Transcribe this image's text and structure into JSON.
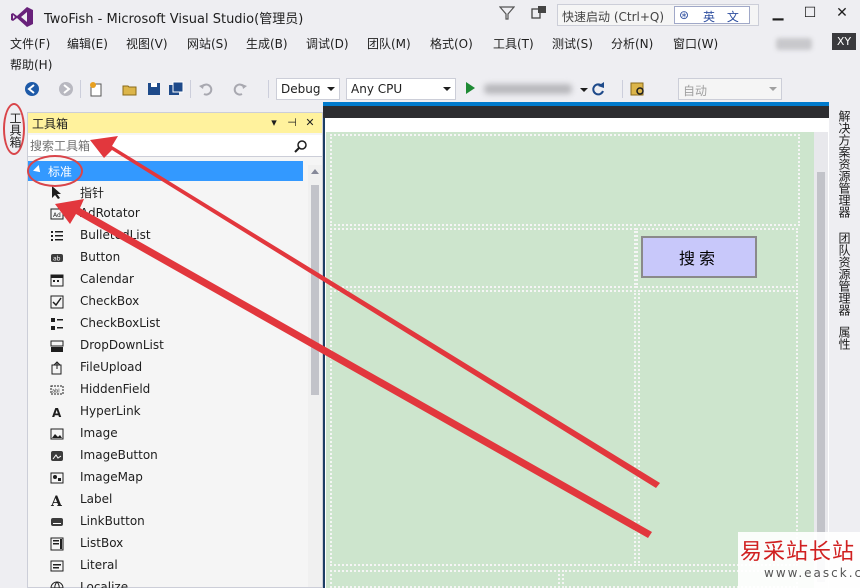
{
  "window": {
    "title": "TwoFish - Microsoft Visual Studio(管理员)",
    "quick_launch_placeholder": "快速启动 (Ctrl+Q)",
    "ime_label": "英 文",
    "min": "▁",
    "max": "☐",
    "close": "✕"
  },
  "menu": {
    "items": [
      "文件(F)",
      "编辑(E)",
      "视图(V)",
      "网站(S)",
      "生成(B)",
      "调试(D)",
      "团队(M)",
      "格式(O)",
      "工具(T)",
      "测试(S)",
      "分析(N)",
      "窗口(W)",
      "帮助(H)"
    ],
    "avatar_initials": "XY"
  },
  "toolbar": {
    "configuration": "Debug",
    "platform": "Any CPU",
    "auto_dropdown": "自动"
  },
  "left_tab": {
    "label": "工具箱"
  },
  "toolbox": {
    "title": "工具箱",
    "pin_glyph": "⊣",
    "dropdown_glyph": "▾",
    "close_glyph": "✕",
    "search_placeholder": "搜索工具箱",
    "category": "标准",
    "items": [
      {
        "label": "指针",
        "icon": "pointer-icon"
      },
      {
        "label": "AdRotator",
        "icon": "adrotator-icon"
      },
      {
        "label": "BulletedList",
        "icon": "bulletedlist-icon"
      },
      {
        "label": "Button",
        "icon": "button-icon"
      },
      {
        "label": "Calendar",
        "icon": "calendar-icon"
      },
      {
        "label": "CheckBox",
        "icon": "checkbox-icon"
      },
      {
        "label": "CheckBoxList",
        "icon": "checkboxlist-icon"
      },
      {
        "label": "DropDownList",
        "icon": "dropdownlist-icon"
      },
      {
        "label": "FileUpload",
        "icon": "fileupload-icon"
      },
      {
        "label": "HiddenField",
        "icon": "hiddenfield-icon"
      },
      {
        "label": "HyperLink",
        "icon": "hyperlink-icon"
      },
      {
        "label": "Image",
        "icon": "image-icon"
      },
      {
        "label": "ImageButton",
        "icon": "imagebutton-icon"
      },
      {
        "label": "ImageMap",
        "icon": "imagemap-icon"
      },
      {
        "label": "Label",
        "icon": "label-icon"
      },
      {
        "label": "LinkButton",
        "icon": "linkbutton-icon"
      },
      {
        "label": "ListBox",
        "icon": "listbox-icon"
      },
      {
        "label": "Literal",
        "icon": "literal-icon"
      },
      {
        "label": "Localize",
        "icon": "localize-icon"
      }
    ]
  },
  "designer": {
    "search_button_label": "搜索"
  },
  "right_tabs": [
    "解决方案资源管理器",
    "团队资源管理器",
    "属性"
  ],
  "watermark": {
    "title": "易采站长站",
    "url": "www.easck.com"
  },
  "colors": {
    "toolbox_header": "#fff29d",
    "category_selected": "#3399ff",
    "design_surface": "#cde5cd",
    "annotation_red": "#d9454a"
  }
}
